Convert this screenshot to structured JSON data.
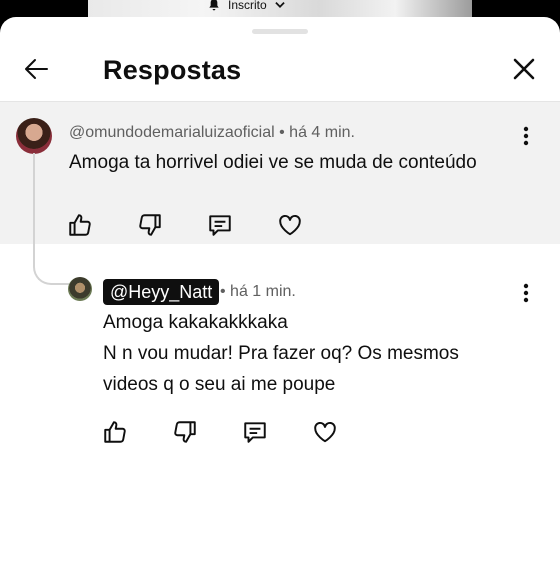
{
  "topbar": {
    "subscribed_label": "Inscrito"
  },
  "header": {
    "title": "Respostas"
  },
  "parent_comment": {
    "author": "@omundodemarialuizaoficial",
    "time": " • há 4 min.",
    "lines": [
      "Amoga ta horrivel odiei ve se muda de conteúdo"
    ]
  },
  "reply_comment": {
    "author": "@Heyy_Natt",
    "time": " • há 1 min.",
    "lines": [
      "Amoga kakakakkkaka",
      "N n vou mudar! Pra fazer oq? Os mesmos",
      "videos q o seu ai me poupe"
    ]
  },
  "colors": {
    "sheet_bg": "#ffffff",
    "parent_bg": "#f2f2f2",
    "author_chip_bg": "#0f0f0f",
    "meta_text": "#606060"
  },
  "icons": [
    "bell-icon",
    "chevron-down-icon",
    "back-arrow-icon",
    "close-icon",
    "more-vertical-icon",
    "thumbs-up-icon",
    "thumbs-down-icon",
    "reply-icon",
    "heart-icon"
  ]
}
